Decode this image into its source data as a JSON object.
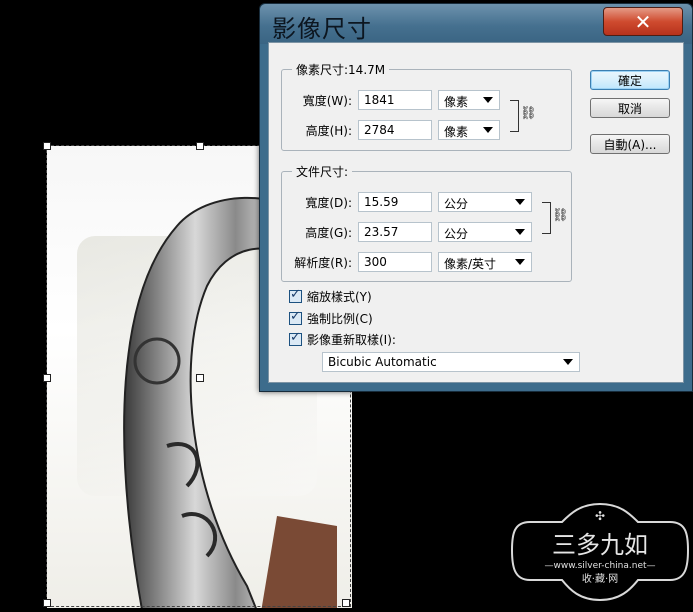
{
  "dialog": {
    "title": "影像尺寸",
    "close_label": "✕",
    "pixel_dimensions": {
      "label": "像素尺寸:14.7M",
      "width_label": "寬度(W):",
      "width_value": "1841",
      "width_unit": "像素",
      "height_label": "高度(H):",
      "height_value": "2784",
      "height_unit": "像素"
    },
    "document_size": {
      "label": "文件尺寸:",
      "width_label": "寬度(D):",
      "width_value": "15.59",
      "width_unit": "公分",
      "height_label": "高度(G):",
      "height_value": "23.57",
      "height_unit": "公分",
      "resolution_label": "解析度(R):",
      "resolution_value": "300",
      "resolution_unit": "像素/英寸"
    },
    "checkboxes": {
      "scale_styles": "縮放樣式(Y)",
      "constrain_proportions": "強制比例(C)",
      "resample_image": "影像重新取樣(I):"
    },
    "resample_method": "Bicubic Automatic",
    "buttons": {
      "ok": "確定",
      "cancel": "取消",
      "auto": "自動(A)..."
    }
  },
  "watermark": {
    "name": "三多九如",
    "url": "—www.silver-china.net—",
    "subtitle": "收·藏·网"
  }
}
